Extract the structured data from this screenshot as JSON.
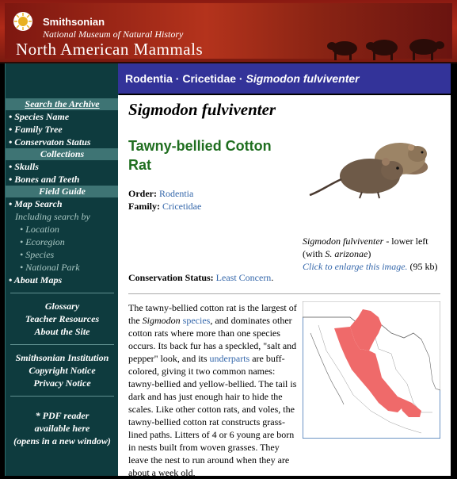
{
  "header": {
    "org_name": "Smithsonian",
    "museum": "National Museum of Natural History",
    "site_title": "North American Mammals"
  },
  "breadcrumb": {
    "order": "Rodentia",
    "sep1": " · ",
    "family": "Cricetidae",
    "sep2": " · ",
    "species": "Sigmodon fulviventer"
  },
  "sidebar": {
    "archive": {
      "heading": "Search the Archive",
      "items": [
        "• Species Name",
        "• Family Tree",
        "• Conservaton Status"
      ]
    },
    "collections": {
      "heading": "Collections",
      "items": [
        "• Skulls",
        "• Bones and Teeth"
      ]
    },
    "field_guide": {
      "heading": "Field Guide",
      "map_search": "• Map Search",
      "including": "Including search by",
      "sub_items": [
        "• Location",
        "• Ecoregion",
        "• Species",
        "• National Park"
      ],
      "about_maps": "• About Maps"
    },
    "resources": [
      "Glossary",
      "Teacher Resources",
      "About the Site"
    ],
    "legal": [
      "Smithsonian Institution",
      "Copyright Notice",
      "Privacy Notice"
    ],
    "pdf_note": [
      "* PDF reader",
      "available here",
      "(opens in a new window)"
    ]
  },
  "main": {
    "scientific_name": "Sigmodon fulviventer",
    "common_name": "Tawny-bellied Cotton Rat",
    "order_label": "Order:",
    "order_value": "Rodentia",
    "family_label": "Family:",
    "family_value": "Cricetidae",
    "caption_species": "Sigmodon fulviventer",
    "caption_text1": " - lower left (with ",
    "caption_species2": "S. arizonae",
    "caption_text2": ")",
    "caption_link": "Click to enlarge this image.",
    "caption_size": " (95 kb)",
    "conservation_label": "Conservation Status:",
    "conservation_value": "Least Concern",
    "conservation_end": ".",
    "body": {
      "p1": "The tawny-bellied cotton rat is the largest of the ",
      "p1_italic": "Sigmodon",
      "p1_link": "species",
      "p2": ", and dominates other cotton rats where more than one species occurs. Its back fur has a speckled, \"salt and pepper\" look, and its ",
      "p2_link": "underparts",
      "p3": " are buff-colored, giving it two common names: tawny-bellied and yellow-bellied. The tail is dark and has just enough hair to hide the scales. Like other cotton rats, and voles, the tawny-bellied cotton rat constructs grass-lined paths. Litters of 4 or 6 young are born in nests built from woven grasses. They leave the nest to run around when they are about a week old,"
    }
  },
  "colors": {
    "header_red": "#b02a18",
    "sidebar_teal": "#0e3b3e",
    "sidebar_heading": "#3e7474",
    "breadcrumb_blue": "#333399",
    "common_name_green": "#1f6e1f",
    "link_blue": "#3366aa",
    "range_red": "#ef6a6a"
  }
}
